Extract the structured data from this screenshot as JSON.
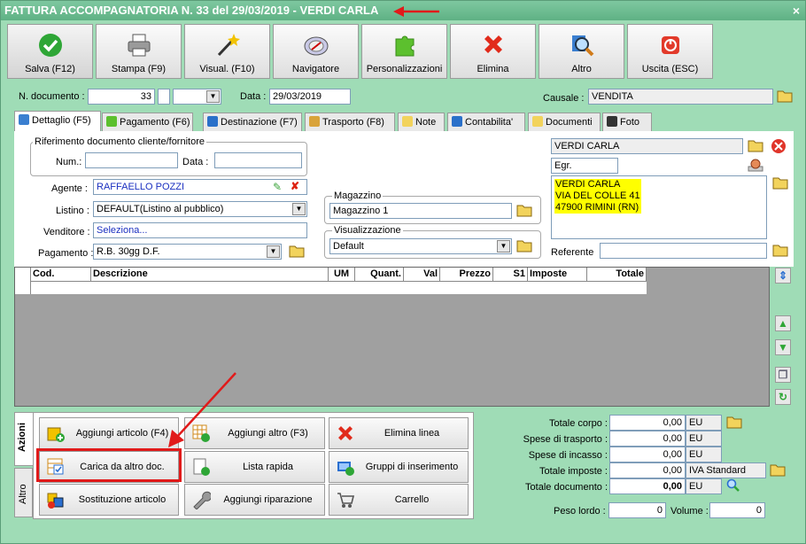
{
  "window": {
    "title": "FATTURA ACCOMPAGNATORIA N. 33 del 29/03/2019 - VERDI CARLA",
    "close": "×"
  },
  "toolbar": [
    {
      "label": "Salva (F12)",
      "icon": "check-icon"
    },
    {
      "label": "Stampa (F9)",
      "icon": "printer-icon"
    },
    {
      "label": "Visual. (F10)",
      "icon": "magic-wand-icon"
    },
    {
      "label": "Navigatore",
      "icon": "compass-icon"
    },
    {
      "label": "Personalizzazioni",
      "icon": "puzzle-icon"
    },
    {
      "label": "Elimina",
      "icon": "delete-x-icon"
    },
    {
      "label": "Altro",
      "icon": "magnifier-icon"
    },
    {
      "label": "Uscita (ESC)",
      "icon": "exit-icon"
    }
  ],
  "header": {
    "ndoc_label": "N. documento :",
    "ndoc_value": "33",
    "data_label": "Data :",
    "data_value": "29/03/2019",
    "causale_label": "Causale :",
    "causale_value": "VENDITA"
  },
  "tabs": [
    "Dettaglio (F5)",
    "Pagamento (F6)",
    "Destinazione (F7)",
    "Trasporto (F8)",
    "Note",
    "Contabilita'",
    "Documenti",
    "Foto"
  ],
  "riferimento": {
    "title": "Riferimento documento cliente/fornitore",
    "num_label": "Num.:",
    "data_label": "Data :"
  },
  "form": {
    "agente_label": "Agente :",
    "agente_value": "RAFFAELLO POZZI",
    "listino_label": "Listino :",
    "listino_value": "DEFAULT(Listino al pubblico)",
    "venditore_label": "Venditore :",
    "venditore_value": "Seleziona...",
    "pagamento_label": "Pagamento :",
    "pagamento_value": "R.B. 30gg D.F."
  },
  "magazzino": {
    "title": "Magazzino",
    "value": "Magazzino 1"
  },
  "visualizzazione": {
    "title": "Visualizzazione",
    "value": "Default"
  },
  "cliente": {
    "name": "VERDI CARLA",
    "title": "Egr.",
    "address": [
      "VERDI CARLA",
      "VIA DEL COLLE 41",
      "47900 RIMINI (RN)"
    ],
    "referente_label": "Referente"
  },
  "grid": {
    "columns": [
      "Cod.",
      "Descrizione",
      "UM",
      "Quant.",
      "Val",
      "Prezzo",
      "S1",
      "Imposte",
      "Totale"
    ]
  },
  "side_tabs": [
    "Azioni",
    "Altro"
  ],
  "actions": [
    "Aggiungi articolo (F4)",
    "Aggiungi altro (F3)",
    "Elimina linea",
    "Carica da altro doc.",
    "Lista rapida",
    "Gruppi di inserimento",
    "Sostituzione articolo",
    "Aggiungi riparazione",
    "Carrello"
  ],
  "totals": [
    {
      "label": "Totale corpo :",
      "value": "0,00",
      "unit": "EU"
    },
    {
      "label": "Spese di trasporto :",
      "value": "0,00",
      "unit": "EU"
    },
    {
      "label": "Spese di incasso :",
      "value": "0,00",
      "unit": "EU"
    },
    {
      "label": "Totale imposte :",
      "value": "0,00",
      "unit": "IVA Standard"
    },
    {
      "label": "Totale documento :",
      "value": "0,00",
      "unit": "EU"
    }
  ],
  "weights": {
    "peso_label": "Peso lordo :",
    "peso_value": "0",
    "volume_label": "Volume :",
    "volume_value": "0"
  },
  "colors": {
    "window_bg": "#9fdcb6",
    "title_bg": "#5fb184",
    "highlight_red": "#e11a1a",
    "address_bg": "#ffff00",
    "grid_bg": "#a0a0a0"
  }
}
